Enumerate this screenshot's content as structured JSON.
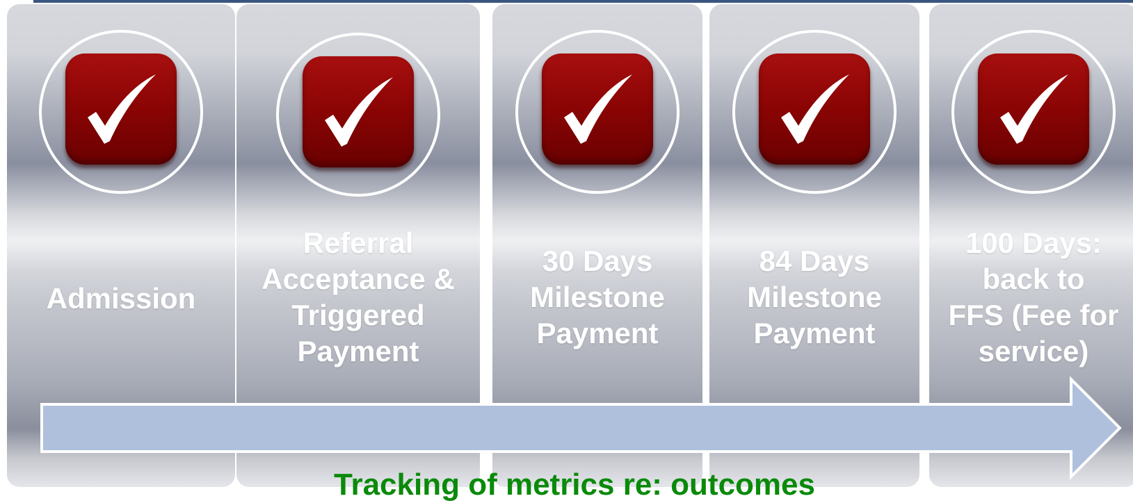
{
  "colors": {
    "top_line": "#3a5580",
    "check_fill": "#8a0404",
    "check_mark": "#ffffff",
    "label_text": "#ffffff",
    "arrow_fill": "#afc0dc",
    "arrow_stroke": "#ffffff",
    "tracking_text": "#0a8a0a"
  },
  "steps": [
    {
      "icon": "checkmark-icon",
      "lines": [
        "Admission"
      ]
    },
    {
      "icon": "checkmark-icon",
      "lines": [
        "Referral",
        "Acceptance &",
        "Triggered",
        "Payment"
      ]
    },
    {
      "icon": "checkmark-icon",
      "lines": [
        "30 Days",
        "Milestone",
        "Payment"
      ]
    },
    {
      "icon": "checkmark-icon",
      "lines": [
        "84 Days",
        "Milestone",
        "Payment"
      ]
    },
    {
      "icon": "checkmark-icon",
      "lines": [
        "100 Days:",
        "back to",
        "FFS (Fee for",
        "service)"
      ]
    }
  ],
  "timeline_arrow": {
    "icon": "right-arrow-icon"
  },
  "footer": {
    "tracking_text": "Tracking of metrics re: outcomes"
  }
}
